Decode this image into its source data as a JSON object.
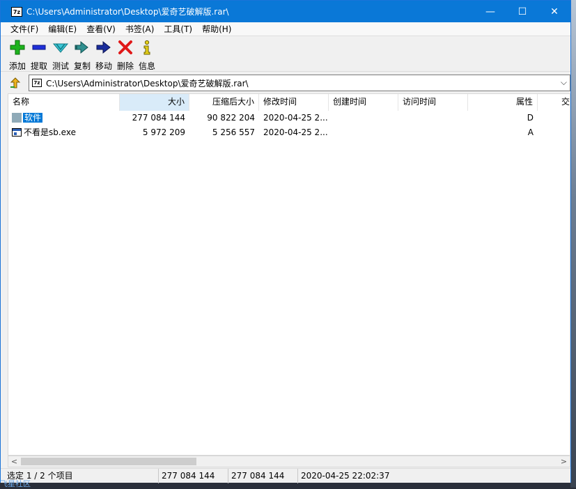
{
  "window": {
    "title": "C:\\Users\\Administrator\\Desktop\\爱奇艺破解版.rar\\",
    "app_icon_text": "7z",
    "minimize_glyph": "—",
    "maximize_glyph": "☐",
    "close_glyph": "✕"
  },
  "menu": [
    "文件(F)",
    "编辑(E)",
    "查看(V)",
    "书签(A)",
    "工具(T)",
    "帮助(H)"
  ],
  "toolbar": {
    "add": "添加",
    "extract": "提取",
    "test": "测试",
    "copy": "复制",
    "move": "移动",
    "delete": "删除",
    "info": "信息"
  },
  "address": {
    "path": "C:\\Users\\Administrator\\Desktop\\爱奇艺破解版.rar\\",
    "icon_text": "7z"
  },
  "columns": [
    "名称",
    "大小",
    "压缩后大小",
    "修改时间",
    "创建时间",
    "访问时间",
    "属性",
    "交"
  ],
  "rows": [
    {
      "name": "软件",
      "size": "277 084 144",
      "packed": "90 822 204",
      "modified": "2020-04-25 2...",
      "created": "",
      "accessed": "",
      "attr": "D",
      "icon": "folder-icon",
      "selected": true
    },
    {
      "name": "不看是sb.exe",
      "size": "5 972 209",
      "packed": "5 256 557",
      "modified": "2020-04-25 2...",
      "created": "",
      "accessed": "",
      "attr": "A",
      "icon": "exe-file-icon",
      "selected": false
    }
  ],
  "status": {
    "selection": "选定 1 / 2 个项目",
    "size": "277 084 144",
    "packed": "277 084 144",
    "time": "2020-04-25 22:02:37"
  },
  "watermark": "飞星社区",
  "colors": {
    "titlebar": "#0a78d7",
    "selection": "#0078d7",
    "sorted_header": "#d9ebf9"
  }
}
